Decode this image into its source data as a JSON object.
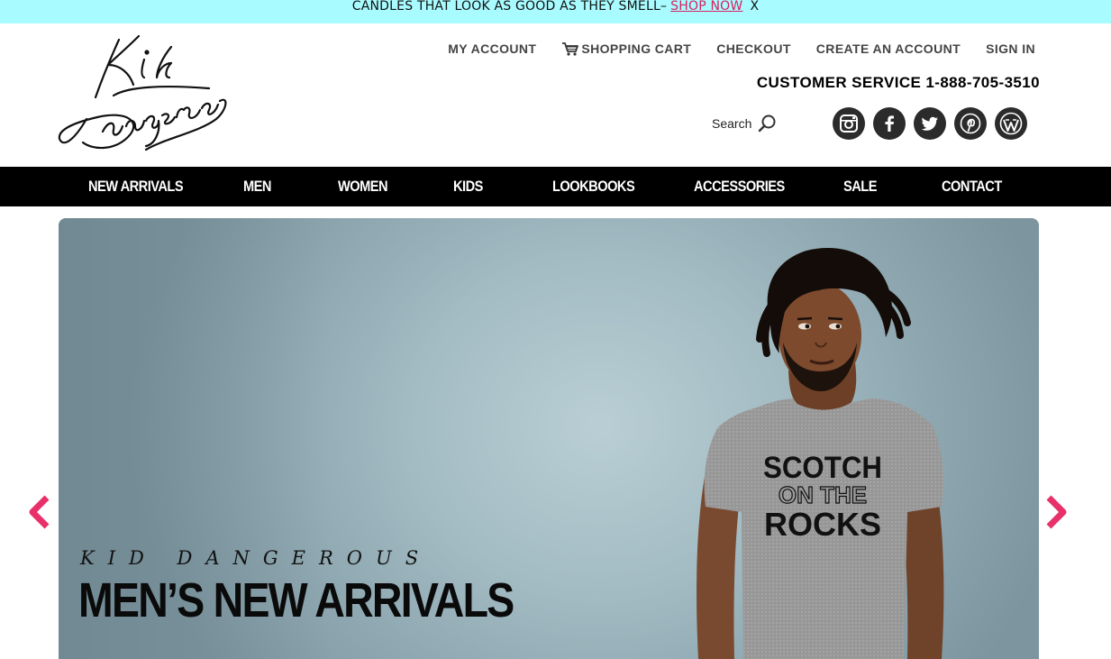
{
  "announcement": {
    "text": "CANDLES THAT LOOK AS GOOD AS THEY SMELL–",
    "link": "SHOP NOW",
    "close": "X"
  },
  "logo": {
    "icon": "kid-dangerous-script-logo"
  },
  "header": {
    "links": {
      "my_account": "MY ACCOUNT",
      "shopping_cart": "SHOPPING CART",
      "checkout": "CHECKOUT",
      "create_account": "CREATE AN ACCOUNT",
      "sign_in": "SIGN IN"
    },
    "customer_service": "CUSTOMER SERVICE 1-888-705-3510",
    "search_label": "Search",
    "social": [
      "instagram-icon",
      "facebook-icon",
      "twitter-icon",
      "pinterest-icon",
      "wordpress-icon"
    ]
  },
  "nav": {
    "items": [
      "NEW ARRIVALS",
      "MEN",
      "WOMEN",
      "KIDS",
      "LOOKBOOKS",
      "ACCESSORIES",
      "SALE",
      "CONTACT"
    ]
  },
  "hero": {
    "kicker": "KID DANGEROUS",
    "title": "MEN’S NEW ARRIVALS",
    "shirt_line1": "SCOTCH",
    "shirt_line2": "ON THE",
    "shirt_line3": "ROCKS"
  },
  "colors": {
    "announce_bg": "#a8fbff",
    "accent": "#e8306a",
    "nav_bg": "#000000"
  }
}
